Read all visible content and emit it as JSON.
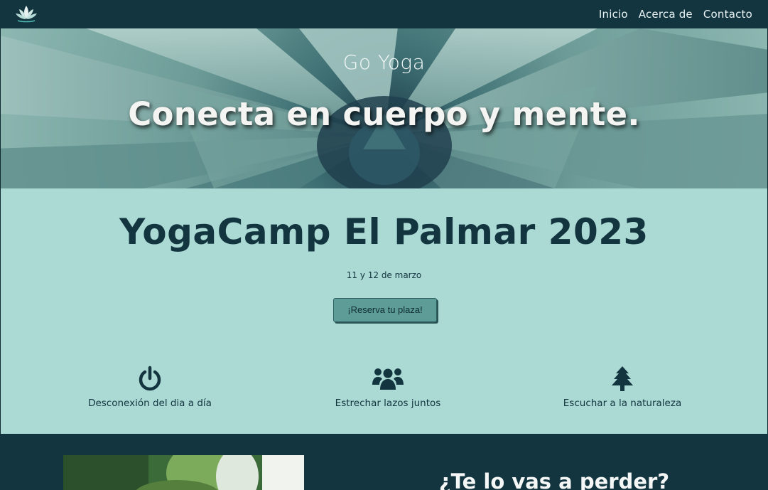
{
  "nav": {
    "logo_icon": "lotus-icon",
    "links": [
      "Inicio",
      "Acerca de",
      "Contacto"
    ]
  },
  "hero": {
    "brand": "Go Yoga",
    "tagline": "Conecta en cuerpo y mente."
  },
  "event": {
    "title": "YogaCamp El Palmar 2023",
    "date": "11 y 12 de marzo",
    "cta_label": "¡Reserva tu plaza!",
    "features": [
      {
        "icon": "power-icon",
        "label": "Desconexión del dia a día"
      },
      {
        "icon": "users-icon",
        "label": "Estrechar lazos juntos"
      },
      {
        "icon": "tree-icon",
        "label": "Escuchar a la naturaleza"
      }
    ]
  },
  "promo": {
    "heading": "¿Te lo vas a perder?"
  },
  "colors": {
    "nav_bg": "#133540",
    "event_bg": "#abd9d4",
    "title": "#133540",
    "button": "#5e9c98"
  }
}
